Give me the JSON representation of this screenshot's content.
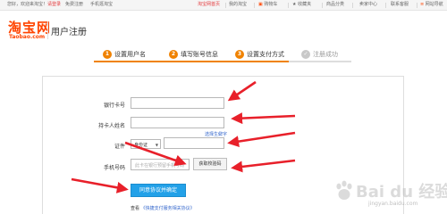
{
  "topbar": {
    "greeting": "您好，欢迎来淘宝！",
    "login": "请登录",
    "register": "免费注册",
    "mobile": "手机逛淘宝",
    "home": "淘宝网首页",
    "my_taobao": "我的淘宝",
    "cart": "购物车",
    "favorites": "收藏夹",
    "categories": "商品分类",
    "seller_center": "卖家中心",
    "support": "联系客服",
    "site_nav": "网站导航"
  },
  "header": {
    "logo": "淘宝网",
    "logo_domain": "Taobao.com",
    "title": "用户注册"
  },
  "steps": [
    {
      "num": "1",
      "label": "设置用户名",
      "state": "done"
    },
    {
      "num": "2",
      "label": "填写账号信息",
      "state": "done"
    },
    {
      "num": "3",
      "label": "设置支付方式",
      "state": "active"
    },
    {
      "num": "✓",
      "label": "注册成功",
      "state": "pending"
    }
  ],
  "form": {
    "bank_card_label": "银行卡号",
    "holder_label": "持卡人姓名",
    "uncommon_char_link": "选择生僻字",
    "id_label": "证件",
    "id_type": "身份证",
    "phone_label": "手机号码",
    "phone_placeholder": "此卡在银行预留手机号码",
    "sms_button": "获取校验码",
    "submit_button": "同意协议并确定",
    "view_prefix": "查看",
    "agreement_link": "《快捷支付服务相关协议》"
  },
  "watermark": {
    "brand": "Bai du 经验",
    "url": "jingyan.baidu.com"
  },
  "colors": {
    "brand_orange": "#ff4400",
    "step_orange": "#f08200",
    "arrow_red": "#e8202a",
    "button_blue": "#23a1e8",
    "link_blue": "#3366cc"
  }
}
